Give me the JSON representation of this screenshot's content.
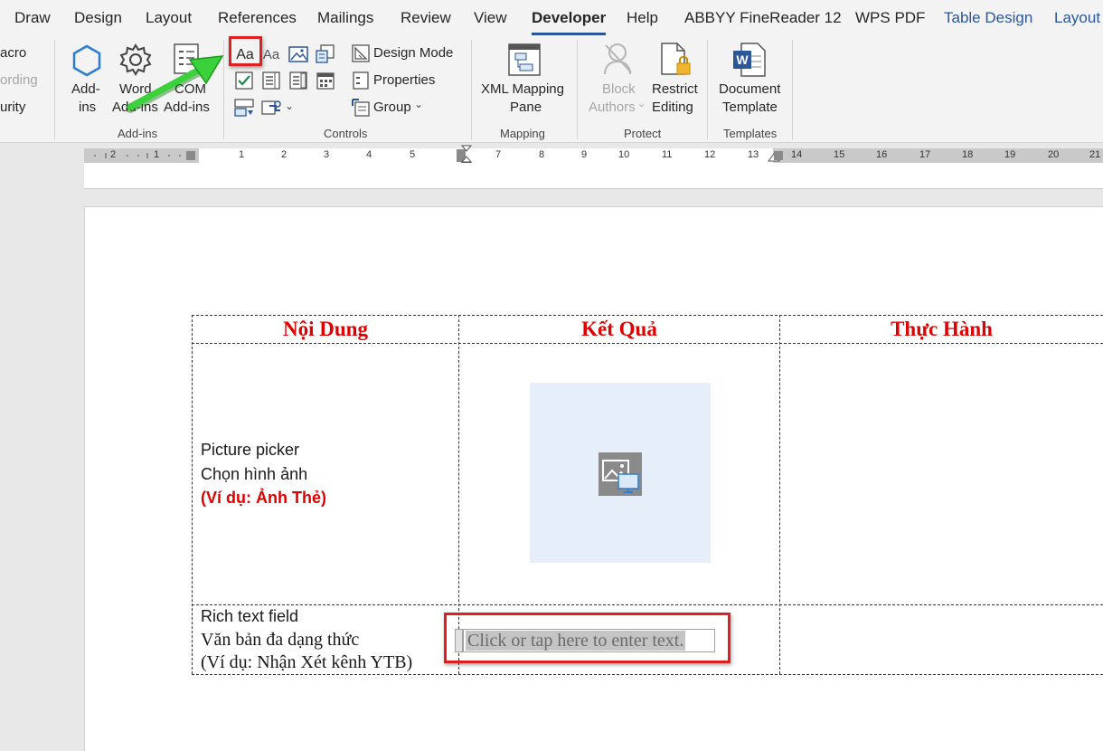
{
  "tabs": [
    "Draw",
    "Design",
    "Layout",
    "References",
    "Mailings",
    "Review",
    "View",
    "Developer",
    "Help",
    "ABBYY FineReader 12",
    "WPS PDF",
    "Table Design",
    "Layout"
  ],
  "code_group": {
    "macro_label": "acro",
    "recording_label": "ording",
    "security_label": "urity"
  },
  "addins_group": {
    "label": "Add-ins",
    "add_ins_line1": "Add-",
    "add_ins_line2": "ins",
    "word_addins_line1": "Word",
    "word_addins_line2": "Add-ins",
    "com_addins_line1": "COM",
    "com_addins_line2": "Add-ins"
  },
  "controls_group": {
    "label": "Controls",
    "rich_text_icon": "Aa",
    "plain_text_icon": "Aa",
    "design_mode": "Design Mode",
    "properties": "Properties",
    "group": "Group"
  },
  "mapping_group": {
    "label": "Mapping",
    "xml_line1": "XML Mapping",
    "xml_line2": "Pane"
  },
  "protect_group": {
    "label": "Protect",
    "block_line1": "Block",
    "block_line2": "Authors",
    "restrict_line1": "Restrict",
    "restrict_line2": "Editing"
  },
  "templates_group": {
    "label": "Templates",
    "doc_line1": "Document",
    "doc_line2": "Template"
  },
  "ruler": {
    "ticks": [
      "2",
      "1",
      "1",
      "2",
      "3",
      "4",
      "5",
      "7",
      "8",
      "9",
      "10",
      "11",
      "12",
      "13",
      "14",
      "15",
      "16",
      "17",
      "18",
      "19",
      "20",
      "21"
    ]
  },
  "table": {
    "headers": [
      "Nội Dung",
      "Kết Quả",
      "Thực Hành"
    ],
    "row1": {
      "line1": "Picture picker",
      "line2": "Chọn hình ảnh",
      "line3": "(Ví dụ: Ảnh Thẻ)"
    },
    "row2": {
      "line1": "Rich text field",
      "line2": "Văn bản đa dạng thức",
      "line3": "(Ví dụ: Nhận Xét kênh YTB)",
      "placeholder": "Click or tap here to enter text."
    }
  },
  "colors": {
    "header_red": "#e00000",
    "highlight_red": "#e02020",
    "arrow_green": "#2ecc40",
    "accent_blue": "#2b579a"
  }
}
